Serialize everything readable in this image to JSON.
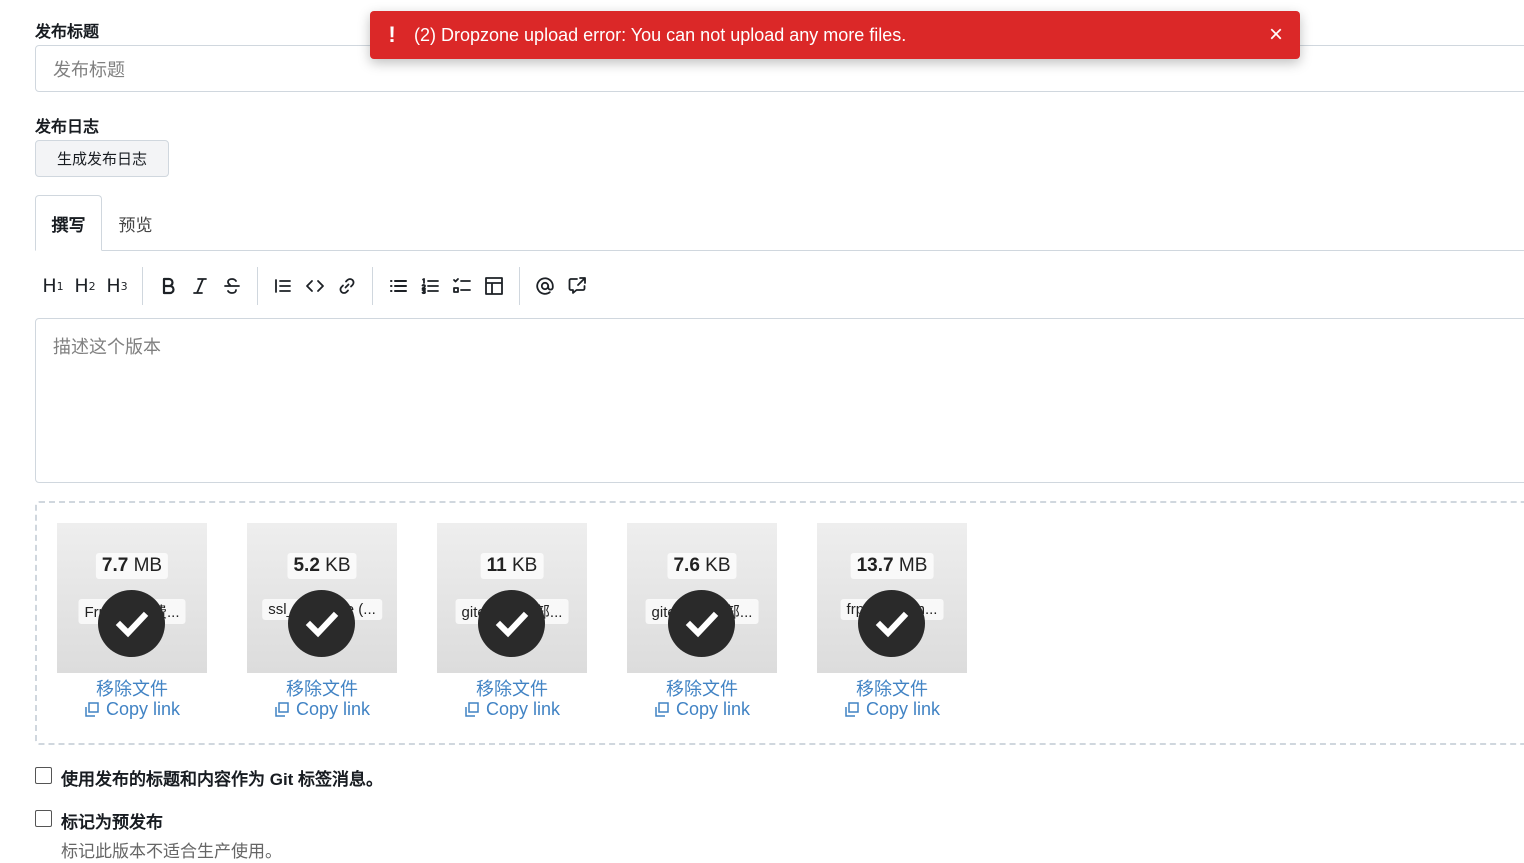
{
  "form": {
    "title_label": "发布标题",
    "title_placeholder": "发布标题",
    "notes_label": "发布日志",
    "generate_button": "生成发布日志"
  },
  "tabs": [
    {
      "label": "撰写",
      "active": true
    },
    {
      "label": "预览",
      "active": false
    }
  ],
  "toolbar": {
    "groups": [
      [
        "heading-1",
        "heading-2",
        "heading-3"
      ],
      [
        "bold",
        "italic",
        "strikethrough"
      ],
      [
        "quote",
        "code",
        "link"
      ],
      [
        "unordered-list",
        "ordered-list",
        "task-list",
        "table"
      ],
      [
        "mention",
        "cross-reference"
      ]
    ]
  },
  "editor": {
    "placeholder": "描述这个版本"
  },
  "files": [
    {
      "size_num": "7.7",
      "size_unit": "MB",
      "name": "Frp二开免费...",
      "remove": "移除文件",
      "copy": "Copy link"
    },
    {
      "size_num": "5.2",
      "size_unit": "KB",
      "name": "ssl_generate (...",
      "remove": "移除文件",
      "copy": "Copy link"
    },
    {
      "size_num": "11",
      "size_unit": "KB",
      "name": "gitea-Linux部...",
      "remove": "移除文件",
      "copy": "Copy link"
    },
    {
      "size_num": "7.6",
      "size_unit": "KB",
      "name": "gitea-Linux部...",
      "remove": "移除文件",
      "copy": "Copy link"
    },
    {
      "size_num": "13.7",
      "size_unit": "MB",
      "name": "frp_0.67_lin...",
      "remove": "移除文件",
      "copy": "Copy link"
    }
  ],
  "options": {
    "tag_message": "使用发布的标题和内容作为 Git 标签消息。",
    "prerelease": "标记为预发布",
    "prerelease_desc": "标记此版本不适合生产使用。"
  },
  "toast": {
    "icon": "!",
    "message": "(2) Dropzone upload error: You can not upload any more files.",
    "close": "×",
    "color": "#db2828"
  },
  "colors": {
    "link": "#4183c4",
    "border": "#d0d7de"
  }
}
